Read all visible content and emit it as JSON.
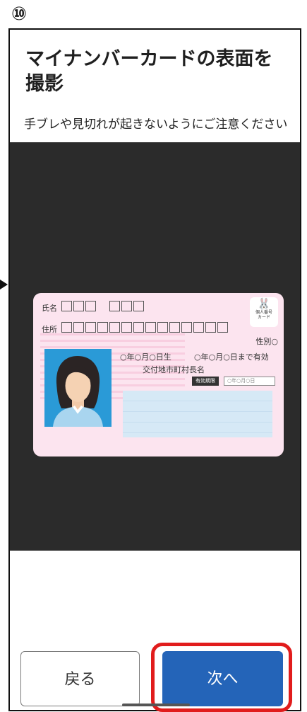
{
  "step_number": "⑩",
  "screen": {
    "title": "マイナンバーカードの表面を撮影",
    "subtitle": "手ブレや見切れが起きないようにご注意ください"
  },
  "card": {
    "name_label": "氏名",
    "address_label": "住所",
    "logo_glyph": "🐰",
    "logo_text_line1": "個人番号",
    "logo_text_line2": "カード",
    "gender": "性別○",
    "birthdate": "○年○月○日生",
    "expiry": "○年○月○日まで有効",
    "issuer": "交付地市町村長名",
    "validity_tag": "有効期限",
    "validity_value": "○年○月○日"
  },
  "buttons": {
    "back": "戻る",
    "next": "次へ"
  },
  "colors": {
    "preview_bg": "#2b2b2b",
    "card_bg": "#fce4ef",
    "next_button": "#2464b8",
    "highlight": "#e11c1c"
  }
}
